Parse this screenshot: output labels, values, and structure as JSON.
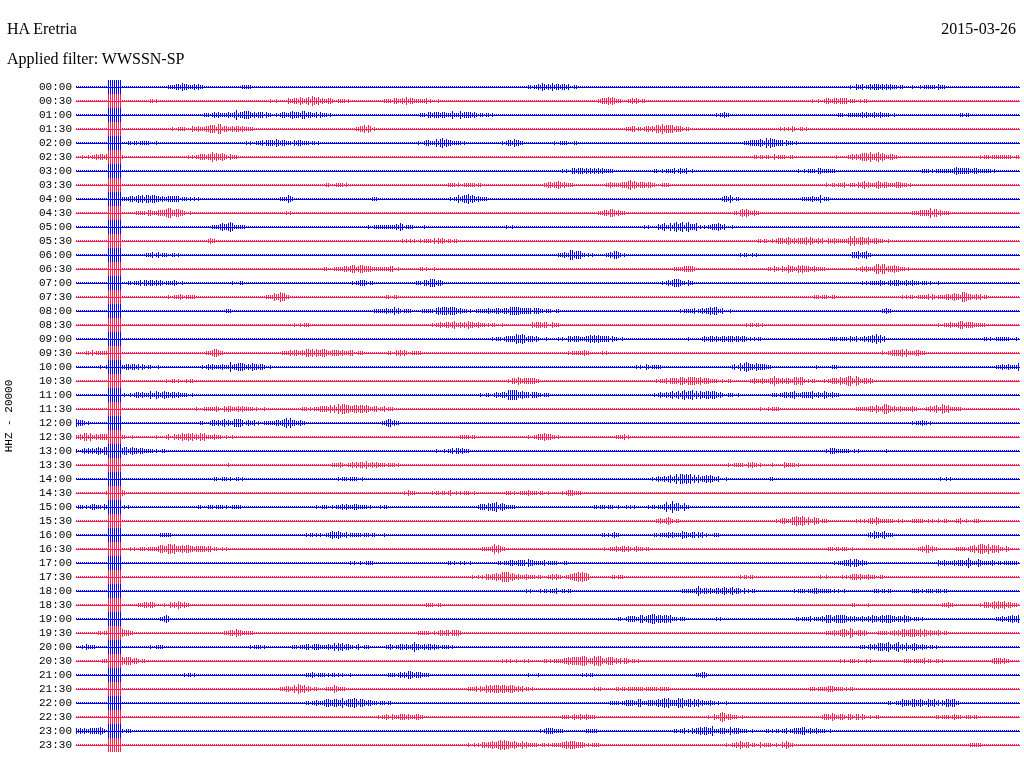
{
  "title": "HA Eretria",
  "date": "2015-03-26",
  "filter": "Applied filter: WWSSN-SP",
  "channel_label": "HHZ - 20000",
  "traces": [
    {
      "time": "00:00",
      "color": "#0000ff"
    },
    {
      "time": "00:30",
      "color": "#ff2050"
    },
    {
      "time": "01:00",
      "color": "#0000ff"
    },
    {
      "time": "01:30",
      "color": "#ff2050"
    },
    {
      "time": "02:00",
      "color": "#0000ff"
    },
    {
      "time": "02:30",
      "color": "#ff2050"
    },
    {
      "time": "03:00",
      "color": "#0000ff"
    },
    {
      "time": "03:30",
      "color": "#ff2050"
    },
    {
      "time": "04:00",
      "color": "#0000ff"
    },
    {
      "time": "04:30",
      "color": "#ff2050"
    },
    {
      "time": "05:00",
      "color": "#0000ff"
    },
    {
      "time": "05:30",
      "color": "#ff2050"
    },
    {
      "time": "06:00",
      "color": "#0000ff"
    },
    {
      "time": "06:30",
      "color": "#ff2050"
    },
    {
      "time": "07:00",
      "color": "#0000ff"
    },
    {
      "time": "07:30",
      "color": "#ff2050"
    },
    {
      "time": "08:00",
      "color": "#0000ff"
    },
    {
      "time": "08:30",
      "color": "#ff2050"
    },
    {
      "time": "09:00",
      "color": "#0000ff"
    },
    {
      "time": "09:30",
      "color": "#ff2050"
    },
    {
      "time": "10:00",
      "color": "#0000ff"
    },
    {
      "time": "10:30",
      "color": "#ff2050"
    },
    {
      "time": "11:00",
      "color": "#0000ff"
    },
    {
      "time": "11:30",
      "color": "#ff2050"
    },
    {
      "time": "12:00",
      "color": "#0000ff"
    },
    {
      "time": "12:30",
      "color": "#ff2050"
    },
    {
      "time": "13:00",
      "color": "#0000ff"
    },
    {
      "time": "13:30",
      "color": "#ff2050"
    },
    {
      "time": "14:00",
      "color": "#0000ff"
    },
    {
      "time": "14:30",
      "color": "#ff2050"
    },
    {
      "time": "15:00",
      "color": "#0000ff"
    },
    {
      "time": "15:30",
      "color": "#ff2050"
    },
    {
      "time": "16:00",
      "color": "#0000ff"
    },
    {
      "time": "16:30",
      "color": "#ff2050"
    },
    {
      "time": "17:00",
      "color": "#0000ff"
    },
    {
      "time": "17:30",
      "color": "#ff2050"
    },
    {
      "time": "18:00",
      "color": "#0000ff"
    },
    {
      "time": "18:30",
      "color": "#ff2050"
    },
    {
      "time": "19:00",
      "color": "#0000ff"
    },
    {
      "time": "19:30",
      "color": "#ff2050"
    },
    {
      "time": "20:00",
      "color": "#0000ff"
    },
    {
      "time": "20:30",
      "color": "#ff2050"
    },
    {
      "time": "21:00",
      "color": "#0000ff"
    },
    {
      "time": "21:30",
      "color": "#ff2050"
    },
    {
      "time": "22:00",
      "color": "#0000ff"
    },
    {
      "time": "22:30",
      "color": "#ff2050"
    },
    {
      "time": "23:00",
      "color": "#0000ff"
    },
    {
      "time": "23:30",
      "color": "#ff2050"
    }
  ]
}
